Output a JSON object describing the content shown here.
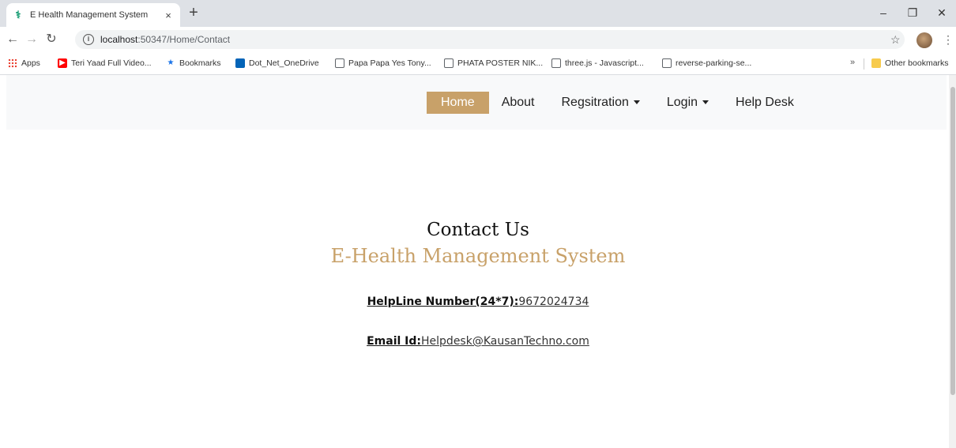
{
  "browser": {
    "tab_title": "E Health Management System",
    "tab_close": "×",
    "new_tab": "+",
    "url_host": "localhost",
    "url_path": ":50347/Home/Contact",
    "window_controls": [
      "–",
      "❐",
      "✕"
    ]
  },
  "bookmarks": {
    "apps": "Apps",
    "items": [
      "Teri Yaad Full Video...",
      "Bookmarks",
      "Dot_Net_OneDrive",
      "Papa Papa Yes Tony...",
      "PHATA POSTER NIK...",
      "three.js - Javascript...",
      "reverse-parking-se..."
    ],
    "more": "»",
    "other": "Other bookmarks"
  },
  "navbar": {
    "home": "Home",
    "about": "About",
    "registration": "Regsitration",
    "login": "Login",
    "helpdesk": "Help Desk",
    "active_color": "#c8a169"
  },
  "content": {
    "heading": "Contact Us",
    "subheading": "E-Health Management System",
    "helpline_label": "HelpLine Number(24*7):",
    "helpline_value": "9672024734",
    "email_label": "Email Id:",
    "email_value": "Helpdesk@KausanTechno.com"
  }
}
